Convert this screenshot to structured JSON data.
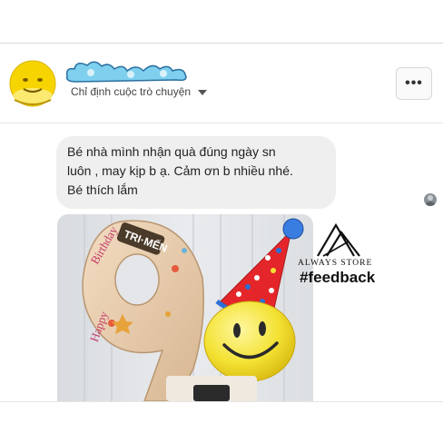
{
  "conversation": {
    "subtitle": "Chỉ định cuộc trò chuyện",
    "more_icon": "more-horizontal-icon"
  },
  "message": {
    "lines": [
      "Bé nhà mình nhận quà đúng ngày sn",
      "luôn , may kịp b ạ. Cảm ơn b nhiều nhé.",
      "Bé thích lắm"
    ]
  },
  "watermark": {
    "brand": "ALWAYS STORE",
    "hashtag": "#feedback"
  },
  "colors": {
    "bubble": "#efefef",
    "divider": "#e6e6e6",
    "balloon_number": "#e8cdb0",
    "smiley": "#f4e43a",
    "party_hat": "#e4262a"
  }
}
